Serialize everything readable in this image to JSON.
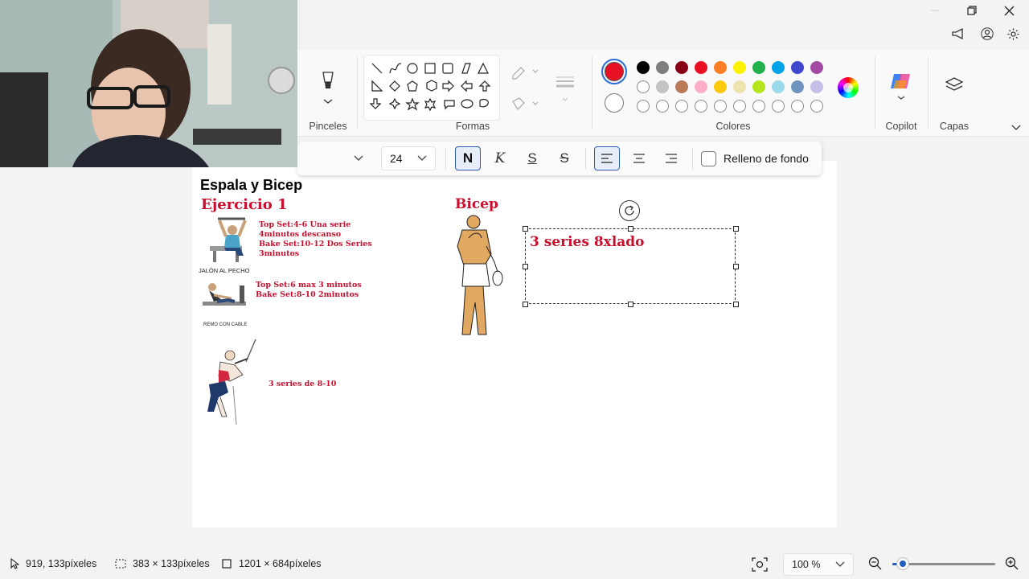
{
  "ribbon": {
    "brushes_label": "Pinceles",
    "shapes_label": "Formas",
    "colors_label": "Colores",
    "copilot_label": "Copilot",
    "layers_label": "Capas",
    "primary_color": "#e81123",
    "secondary_color": "#ffffff",
    "palette_row1": [
      "#000000",
      "#7f7f7f",
      "#880015",
      "#e81123",
      "#ff7f27",
      "#fff200",
      "#22b14c",
      "#00a2e8",
      "#3f48cc",
      "#a349a4"
    ],
    "palette_row2": [
      "#ffffff",
      "#c3c3c3",
      "#b97a57",
      "#ffaec9",
      "#ffc90e",
      "#efe4b0",
      "#b5e61d",
      "#99d9ea",
      "#7092be",
      "#c8bfe7"
    ]
  },
  "text_toolbar": {
    "font_size": "24",
    "bold_label": "N",
    "italic_label": "K",
    "underline_label": "S",
    "strike_label": "S",
    "fill_label": "Relleno de fondo"
  },
  "canvas": {
    "title": "Espala y Bicep",
    "exercise1": "Ejercicio 1",
    "ex1_lines": [
      "Top Set:4-6 Una serie",
      "4minutos descanso",
      "Bake Set:10-12 Dos Series",
      "3minutos"
    ],
    "img1_caption": "JALÓN AL PECHO",
    "ex2_lines": [
      "Top Set:6 max 3 minutos",
      "Bake Set:8-10 2minutos"
    ],
    "img2_caption": "REMO CON CABLE",
    "ex3_text": "3 series de 8-10",
    "bicep_title": "Bicep",
    "textbox_value": "3 series 8xlado"
  },
  "status": {
    "cursor_pos": "919, 133píxeles",
    "selection_size": "383 × 133píxeles",
    "canvas_size": "1201 × 684píxeles",
    "zoom": "100 %",
    "zoom_fraction": 0.1
  }
}
